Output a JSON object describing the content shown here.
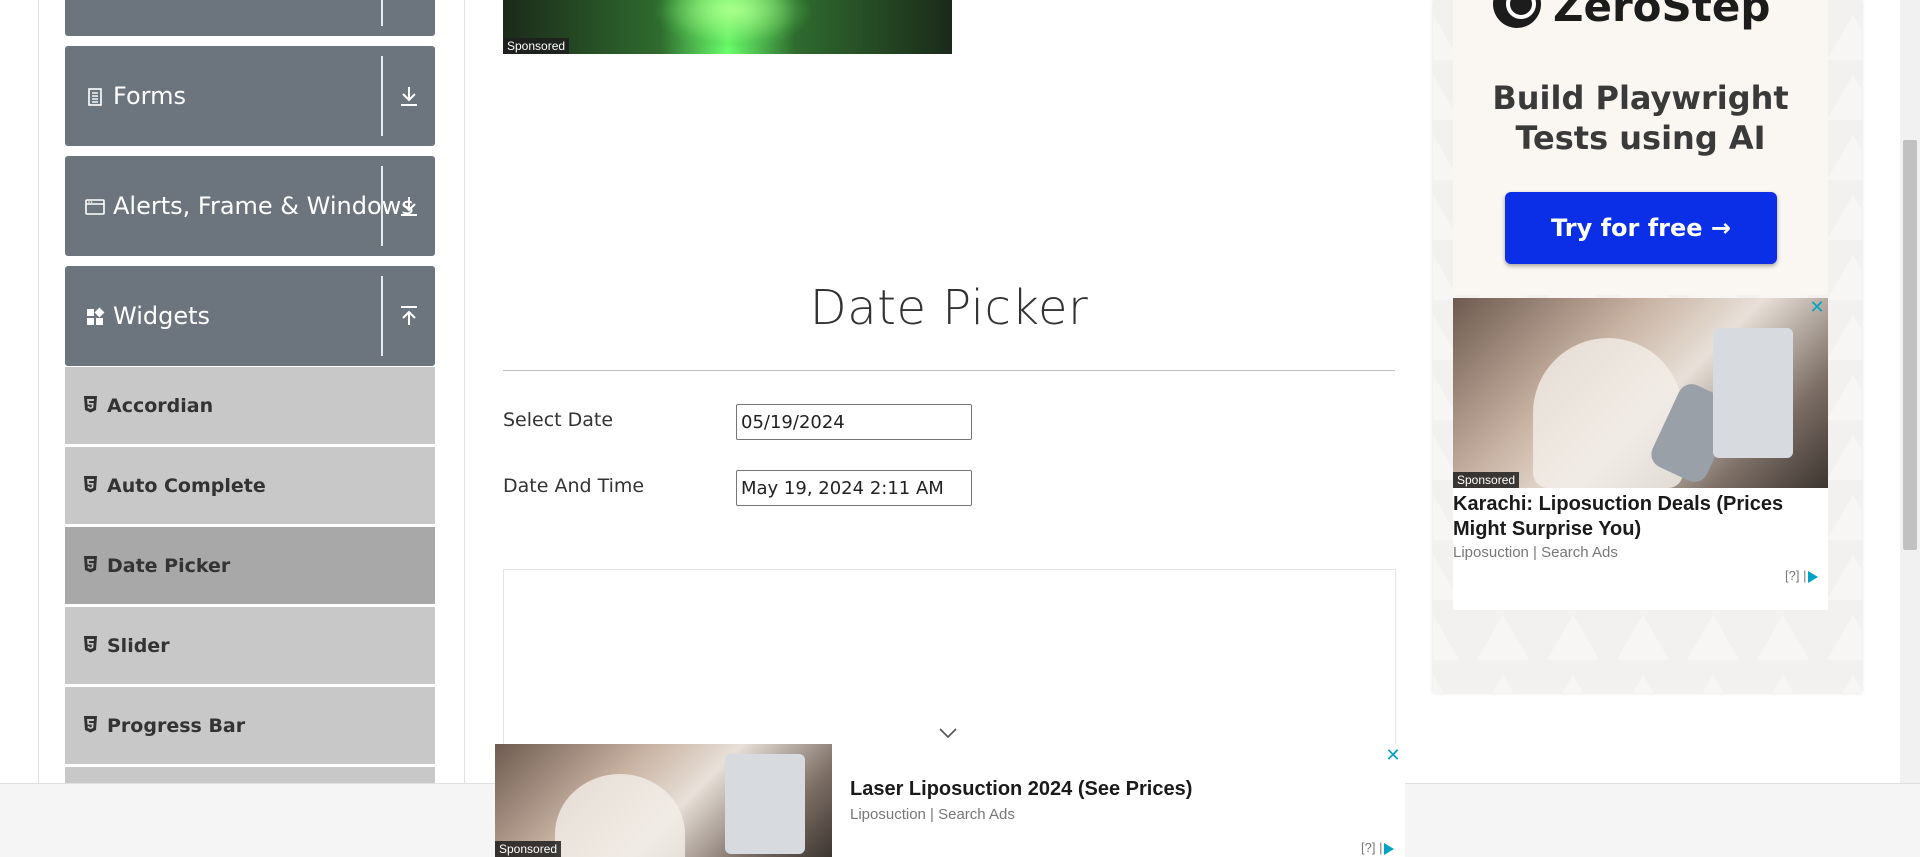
{
  "sidebar": {
    "groups": [
      {
        "label": "Forms",
        "icon": "form-icon",
        "state": "collapsed"
      },
      {
        "label": "Alerts, Frame & Windows",
        "icon": "window-icon",
        "state": "collapsed"
      },
      {
        "label": "Widgets",
        "icon": "widgets-icon",
        "state": "expanded"
      }
    ],
    "items": [
      {
        "label": "Accordian"
      },
      {
        "label": "Auto Complete"
      },
      {
        "label": "Date Picker",
        "active": true
      },
      {
        "label": "Slider"
      },
      {
        "label": "Progress Bar"
      }
    ]
  },
  "main": {
    "hero_sponsored": "Sponsored",
    "title": "Date Picker",
    "select_date": {
      "label": "Select Date",
      "value": "05/19/2024"
    },
    "date_time": {
      "label": "Date And Time",
      "value": "May 19, 2024 2:11 AM"
    }
  },
  "right_ad": {
    "brand": "ZeroStep",
    "headline": "Build Playwright Tests using AI",
    "cta": "Try for free →",
    "card": {
      "sponsored": "Sponsored",
      "title": "Karachi: Liposuction Deals (Prices Might Surprise You)",
      "source": "Liposuction | Search Ads",
      "adchoices": "[?]"
    }
  },
  "bottom_ad": {
    "sponsored": "Sponsored",
    "title": "Laser Liposuction 2024 (See Prices)",
    "source": "Liposuction | Search Ads",
    "adchoices": "[?]"
  },
  "colors": {
    "group_header_bg": "#6c757d",
    "menu_item_bg": "#c8c8c8",
    "menu_item_active_bg": "#a8a8a8",
    "cta_blue": "#0a2fe6",
    "adchoice_teal": "#00a3c4"
  }
}
